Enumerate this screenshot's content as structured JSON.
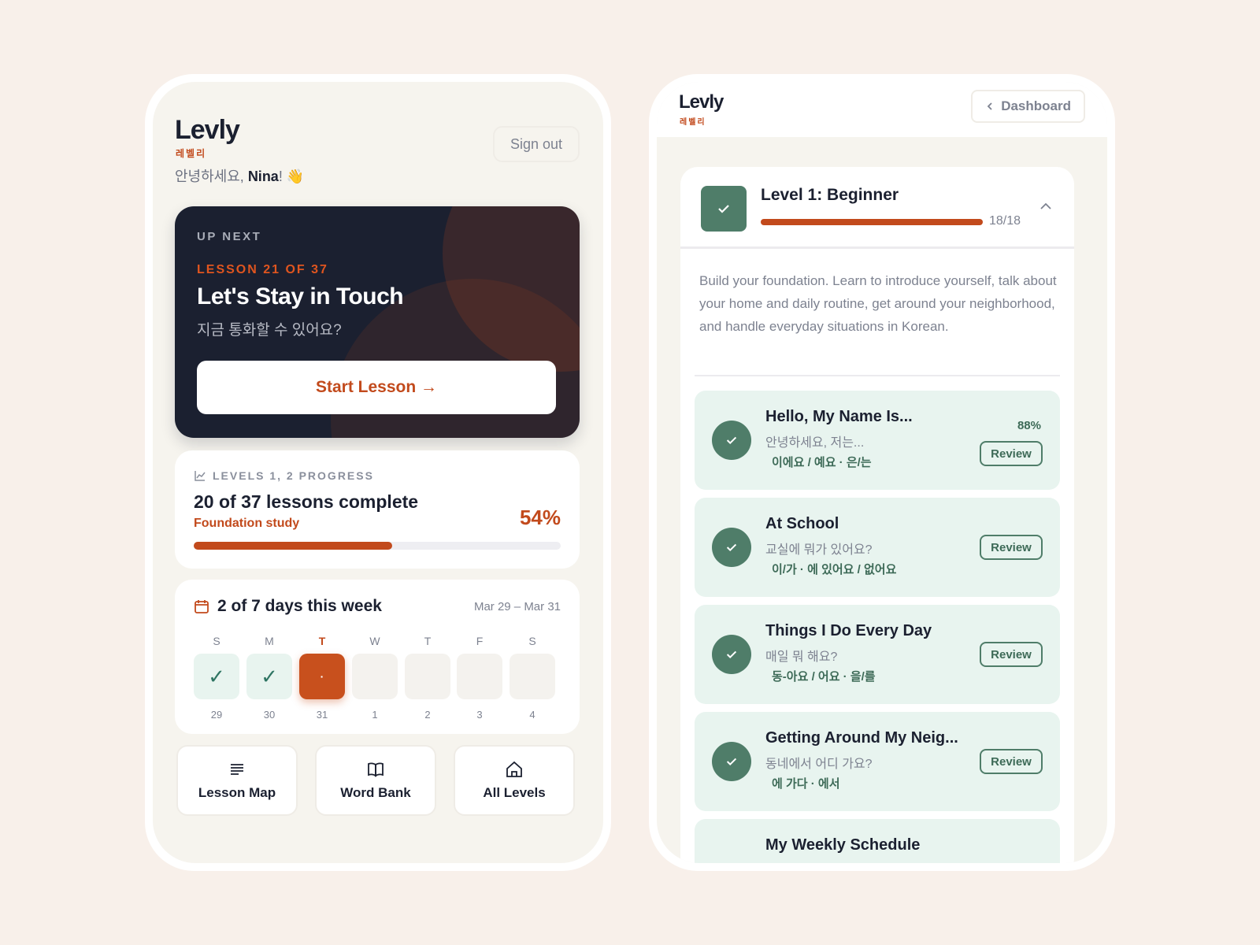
{
  "left": {
    "brand": "Levly",
    "brand_ko": "레벨리",
    "greeting_prefix": "안녕하세요, ",
    "user_name": "Nina",
    "greeting_suffix": "! 👋",
    "signout_label": "Sign out",
    "up_next": {
      "label": "UP NEXT",
      "lesson": "LESSON 21 OF 37",
      "title": "Let's Stay in Touch",
      "title_ko": "지금 통화할 수 있어요?",
      "button": "Start Lesson →"
    },
    "progress": {
      "label": "LEVELS 1, 2 PROGRESS",
      "title": "20 of 37 lessons complete",
      "subtitle": "Foundation study",
      "percent": "54%",
      "fraction": 0.54
    },
    "week": {
      "title": "2 of 7 days this week",
      "range": "Mar 29 – Mar 31",
      "days": [
        {
          "letter": "S",
          "num": "29",
          "mark": "✓"
        },
        {
          "letter": "M",
          "num": "30",
          "mark": "✓"
        },
        {
          "letter": "T",
          "num": "31",
          "mark": "·"
        },
        {
          "letter": "W",
          "num": "1",
          "mark": ""
        },
        {
          "letter": "T",
          "num": "2",
          "mark": ""
        },
        {
          "letter": "F",
          "num": "3",
          "mark": ""
        },
        {
          "letter": "S",
          "num": "4",
          "mark": ""
        }
      ]
    },
    "tiles": {
      "lesson_map": "Lesson Map",
      "word_bank": "Word Bank",
      "all_levels": "All Levels"
    }
  },
  "right": {
    "brand": "Levly",
    "brand_ko": "레벨리",
    "dashboard_label": "Dashboard",
    "level": {
      "title": "Level 1: Beginner",
      "count": "18/18",
      "description": "Build your foundation. Learn to introduce yourself, talk about your home and daily routine, get around your neighborhood, and handle everyday situations in Korean."
    },
    "lessons": [
      {
        "title": "Hello, My Name Is...",
        "ko": "안녕하세요, 저는...",
        "grammar": "이에요 / 예요 · 은/는",
        "score": "88%",
        "review": "Review"
      },
      {
        "title": "At School",
        "ko": "교실에 뭐가 있어요?",
        "grammar": "이/가 · 에 있어요 / 없어요",
        "score": "",
        "review": "Review"
      },
      {
        "title": "Things I Do Every Day",
        "ko": "매일 뭐 해요?",
        "grammar": "동-아요 / 어요 · 을/를",
        "score": "",
        "review": "Review"
      },
      {
        "title": "Getting Around My Neig...",
        "ko": "동네에서 어디 가요?",
        "grammar": "에 가다 · 에서",
        "score": "",
        "review": "Review"
      },
      {
        "title": "My Weekly Schedule",
        "ko": "",
        "grammar": "",
        "score": "",
        "review": ""
      }
    ]
  }
}
